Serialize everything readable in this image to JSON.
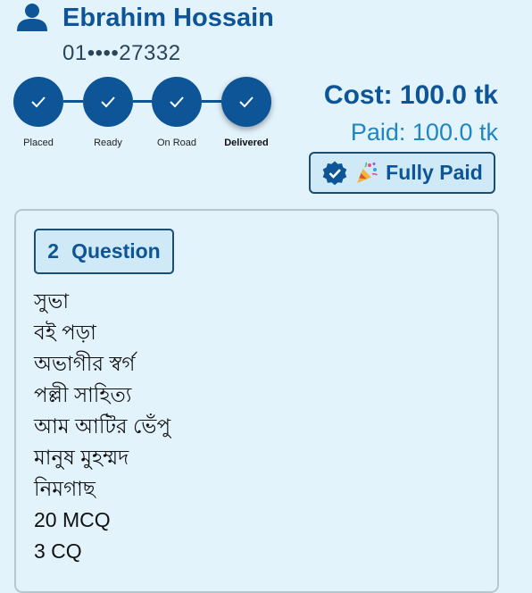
{
  "customer": {
    "name": "Ebrahim Hossain",
    "phone": "01••••27332",
    "icon": "person-icon"
  },
  "order_status": {
    "steps": [
      {
        "label": "Placed",
        "completed": true
      },
      {
        "label": "Ready",
        "completed": true
      },
      {
        "label": "On Road",
        "completed": true
      },
      {
        "label": "Delivered",
        "completed": true,
        "current": true
      }
    ]
  },
  "payment": {
    "cost": "Cost: 100.0 tk",
    "paid": "Paid: 100.0 tk",
    "badge_label": "Fully Paid",
    "badge_icons": [
      "verified-icon",
      "party-popper-icon"
    ]
  },
  "questions": {
    "count": "2",
    "title": "Question",
    "items": [
      "সুভা",
      "বই পড়া",
      "অভাগীর স্বর্গ",
      "পল্লী সাহিত্য",
      "আম আটির ভেঁপু",
      "মানুষ মুহম্মদ",
      "নিমগাছ",
      "20 MCQ",
      "3 CQ"
    ]
  },
  "colors": {
    "primary": "#0d5597",
    "accent": "#1f86c4",
    "background": "#e3f3fc",
    "badge_background": "#cfe9f6"
  }
}
